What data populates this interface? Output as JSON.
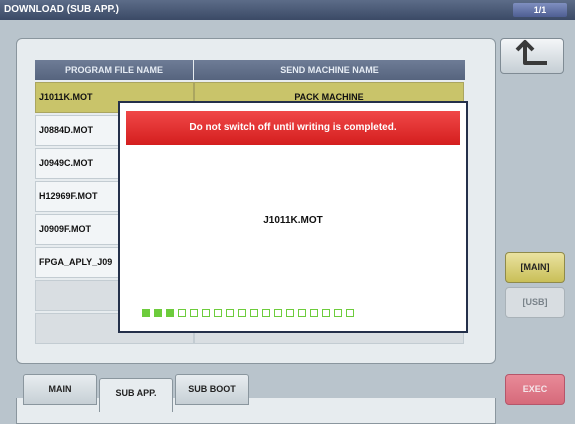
{
  "window": {
    "title": "DOWNLOAD (SUB APP.)",
    "page_indicator": "1/1"
  },
  "table": {
    "headers": [
      "PROGRAM FILE NAME",
      "SEND MACHINE NAME"
    ],
    "rows": [
      {
        "file": "J1011K.MOT",
        "machine": "PACK MACHINE"
      },
      {
        "file": "J0884D.MOT",
        "machine": ""
      },
      {
        "file": "J0949C.MOT",
        "machine": ""
      },
      {
        "file": "H12969F.MOT",
        "machine": ""
      },
      {
        "file": "J0909F.MOT",
        "machine": ""
      },
      {
        "file": "FPGA_APLY_J09",
        "machine": ""
      },
      {
        "file": "",
        "machine": ""
      },
      {
        "file": "",
        "machine": ""
      }
    ]
  },
  "dialog": {
    "warning": "Do not switch off until writing is completed.",
    "filename": "J1011K.MOT",
    "progress_filled": 3,
    "progress_total": 18
  },
  "side": {
    "back_icon": "return-arrow-icon",
    "main_label": "[MAIN]",
    "usb_label": "[USB]",
    "exec_label": "EXEC"
  },
  "tabs": [
    "MAIN",
    "SUB APP.",
    "SUB BOOT"
  ],
  "colors": {
    "title_bar": "#3b4a66",
    "selected_row": "#c9c46a",
    "warning_banner": "#e02a2a",
    "progress": "#6dcc3c",
    "exec_button": "#d66a7a"
  }
}
